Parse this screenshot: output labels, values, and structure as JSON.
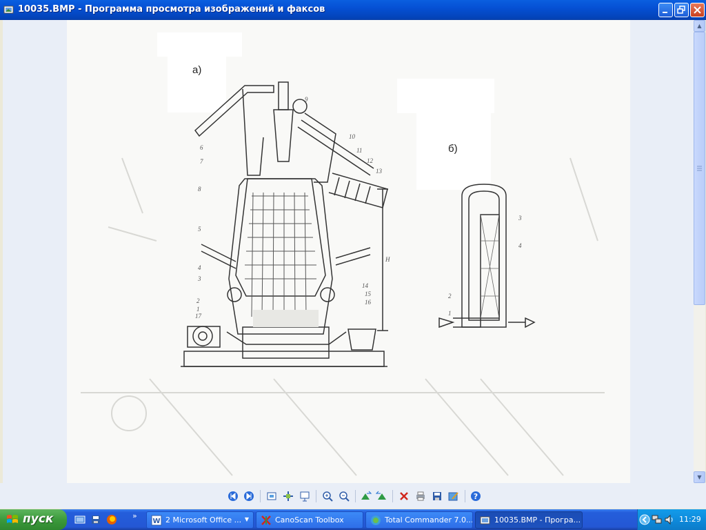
{
  "window": {
    "title": "10035.BMP - Программа просмотра изображений и факсов"
  },
  "image": {
    "label_a": "а)",
    "label_b": "б)"
  },
  "toolbar": {
    "icons": [
      "prev-image-icon",
      "next-image-icon",
      "best-fit-icon",
      "actual-size-icon",
      "slideshow-icon",
      "zoom-in-icon",
      "zoom-out-icon",
      "rotate-clockwise-icon",
      "rotate-counterclockwise-icon",
      "delete-icon",
      "print-icon",
      "save-icon",
      "edit-icon",
      "help-icon"
    ]
  },
  "taskbar": {
    "start_label": "пуск",
    "more": "»",
    "tasks": [
      {
        "label": "2 Microsoft Office ...",
        "icon": "word-icon",
        "active": false,
        "arrow": "▼"
      },
      {
        "label": "CanoScan Toolbox",
        "icon": "canoscan-icon",
        "active": false
      },
      {
        "label": "Total Commander 7.0...",
        "icon": "total-commander-icon",
        "active": false
      },
      {
        "label": "10035.BMP - Програ...",
        "icon": "image-viewer-icon",
        "active": true
      }
    ],
    "clock": "11:29"
  },
  "colors": {
    "titlebar": "#0550D4",
    "taskbar": "#245EDB",
    "start": "#3C9A3C",
    "tray": "#0E8BDC"
  }
}
